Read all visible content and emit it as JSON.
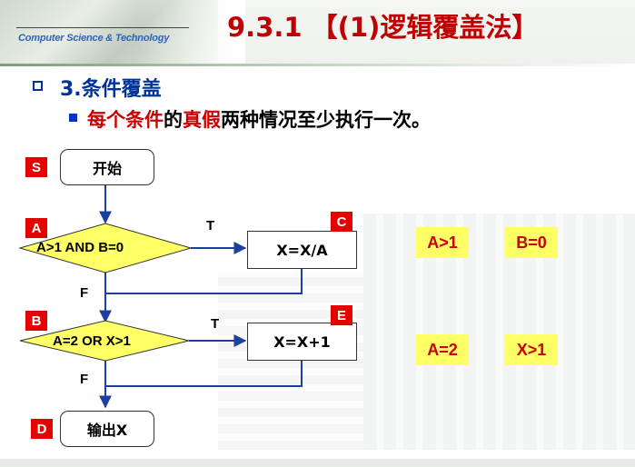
{
  "header": {
    "subtitle_logo": "Computer Science & Technology",
    "title": "9.3.1 【(1)逻辑覆盖法】"
  },
  "content": {
    "section": "3.条件覆盖",
    "point": {
      "part1": "每个条件",
      "part2": "的",
      "part3": "真假",
      "part4": "两种情况至少执行一次。"
    }
  },
  "flowchart": {
    "start": "开始",
    "decision_a": "A>1 AND B=0",
    "box_c": "X=X/A",
    "decision_b": "A=2 OR X>1",
    "box_e": "X=X+1",
    "end": "输出X",
    "tags": {
      "s": "S",
      "a": "A",
      "c": "C",
      "b": "B",
      "e": "E",
      "d": "D"
    },
    "branch_labels": {
      "t1": "T",
      "f1": "F",
      "t2": "T",
      "f2": "F"
    }
  },
  "conditions": [
    "A>1",
    "B=0",
    "A=2",
    "X>1"
  ],
  "colors": {
    "title": "#c00000",
    "section": "#003399",
    "tag": "#e60000",
    "decision_fill": "#ffff66",
    "arrow": "#1f3fa0",
    "condition_text": "#cc0000"
  }
}
